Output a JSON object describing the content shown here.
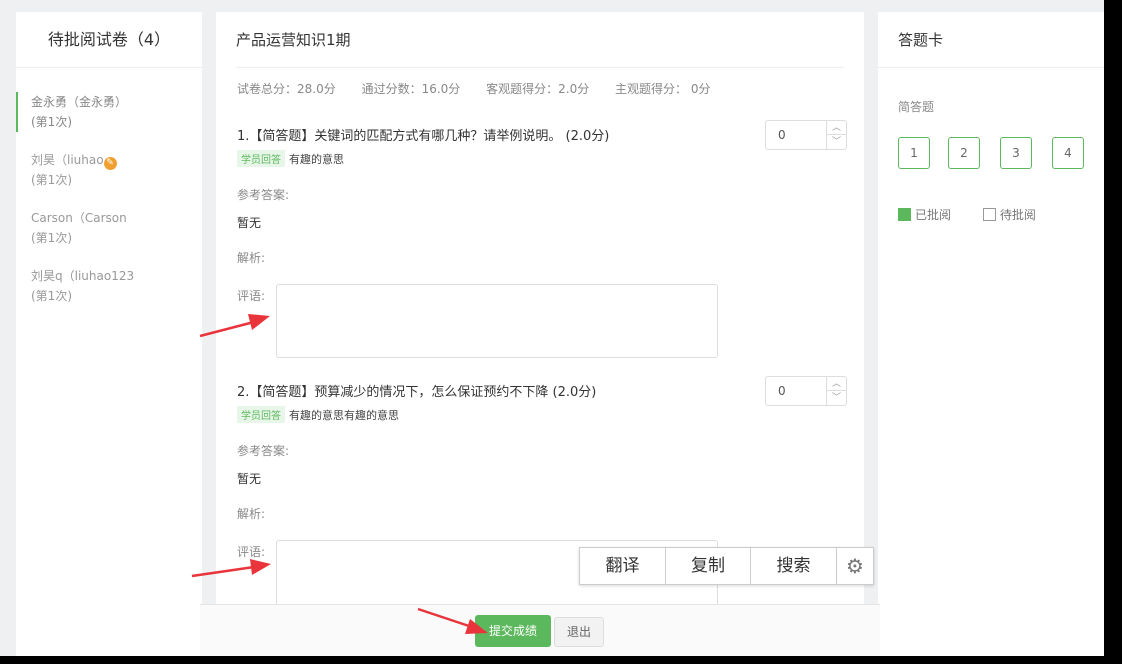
{
  "left": {
    "title": "待批阅试卷（4）",
    "students": [
      {
        "line1": "金永勇（金永勇）",
        "line2": "(第1次)"
      },
      {
        "line1": "刘昊（liuhao",
        "line2": "(第1次)"
      },
      {
        "line1": "Carson（Carson",
        "line2": "(第1次)"
      },
      {
        "line1": "刘昊q（liuhao123",
        "line2": "(第1次)"
      }
    ]
  },
  "main": {
    "title": "产品运营知识1期",
    "scores": {
      "total": "试卷总分：28.0分",
      "pass": "通过分数：16.0分",
      "objective": "客观题得分：2.0分",
      "subjective": "主观题得分： 0分"
    },
    "questions": [
      {
        "title": "1.【简答题】关键词的匹配方式有哪几种？请举例说明。 (2.0分)",
        "answer_tag": "学员回答",
        "answer": "有趣的意思",
        "ref_label": "参考答案:",
        "ref_value": "暂无",
        "analysis_label": "解析:",
        "comment_label": "评语:",
        "score": "0"
      },
      {
        "title": "2.【简答题】预算减少的情况下，怎么保证预约不下降 (2.0分)",
        "answer_tag": "学员回答",
        "answer": "有趣的意思有趣的意思",
        "ref_label": "参考答案:",
        "ref_value": "暂无",
        "analysis_label": "解析:",
        "comment_label": "评语:",
        "score": "0"
      }
    ]
  },
  "right": {
    "title": "答题卡",
    "section": "简答题",
    "numbers": [
      "1",
      "2",
      "3",
      "4"
    ],
    "legend_done": "已批阅",
    "legend_todo": "待批阅"
  },
  "bottom": {
    "submit": "提交成绩",
    "exit": "退出"
  },
  "popup": {
    "translate": "翻译",
    "copy": "复制",
    "search": "搜索"
  },
  "colors": {
    "accent": "#5cb85c",
    "arrow": "#e8343a",
    "badge": "#f0a030"
  }
}
